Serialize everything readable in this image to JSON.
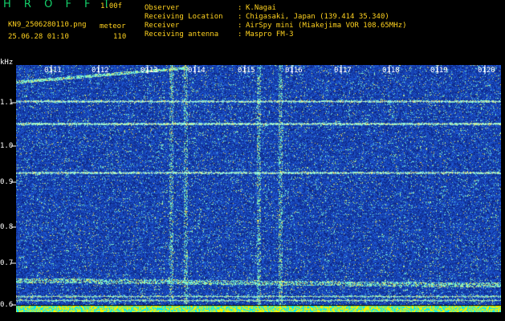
{
  "app": {
    "title": "H R O F F T",
    "version": "1.00f"
  },
  "file": {
    "name": "KN9_2506280110.png",
    "mode": "meteor",
    "datetime": "25.06.28 01:10",
    "count": "110"
  },
  "meta": [
    {
      "key": "Observer",
      "value": "K.Nagai"
    },
    {
      "key": "Receiving Location",
      "value": "Chigasaki, Japan (139.414 35.340)"
    },
    {
      "key": "Receiver",
      "value": "AirSpy mini (Miakejima VOR 108.65MHz)"
    },
    {
      "key": "Receiving antenna",
      "value": "Maspro FM-3"
    }
  ],
  "meta_colon": ":",
  "axis": {
    "unit": "kHz",
    "y_ticks": [
      "1.1",
      "1.0",
      "0.9",
      "0.8",
      "0.7",
      "0.6"
    ],
    "x_ticks": [
      "0111",
      "0112",
      "0113",
      "0114",
      "0115",
      "0116",
      "0117",
      "0118",
      "0119",
      "0120"
    ]
  },
  "colors": {
    "background": "#000000",
    "spectrogram_base": "#0a1a8a",
    "label_yellow": "#ffd21f",
    "title_green": "#14d06a",
    "trace_white": "#e6ffe6",
    "bottom_strip_yellow": "#f4f200",
    "bottom_strip_cyan": "#00e8ff"
  }
}
